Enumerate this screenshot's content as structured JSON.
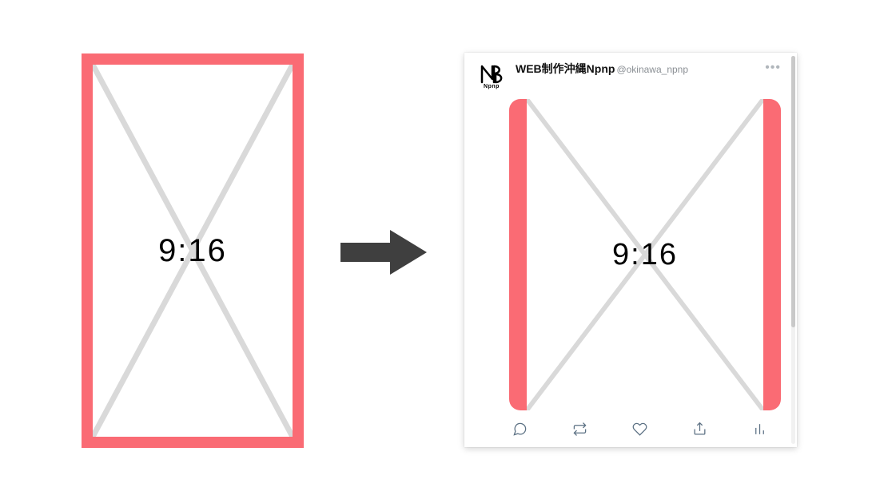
{
  "aspect_ratio_label": "9:16",
  "arrow": {
    "color": "#3f3f3f"
  },
  "tweet": {
    "display_name": "WEB制作沖縄Npnp",
    "handle": "@okinawa_npnp",
    "avatar_text": "Npnp",
    "media_ratio_label": "9:16"
  },
  "colors": {
    "frame_red": "#fa6b74",
    "diag_grey": "#d9d9d9",
    "icon_grey": "#5b7083"
  }
}
